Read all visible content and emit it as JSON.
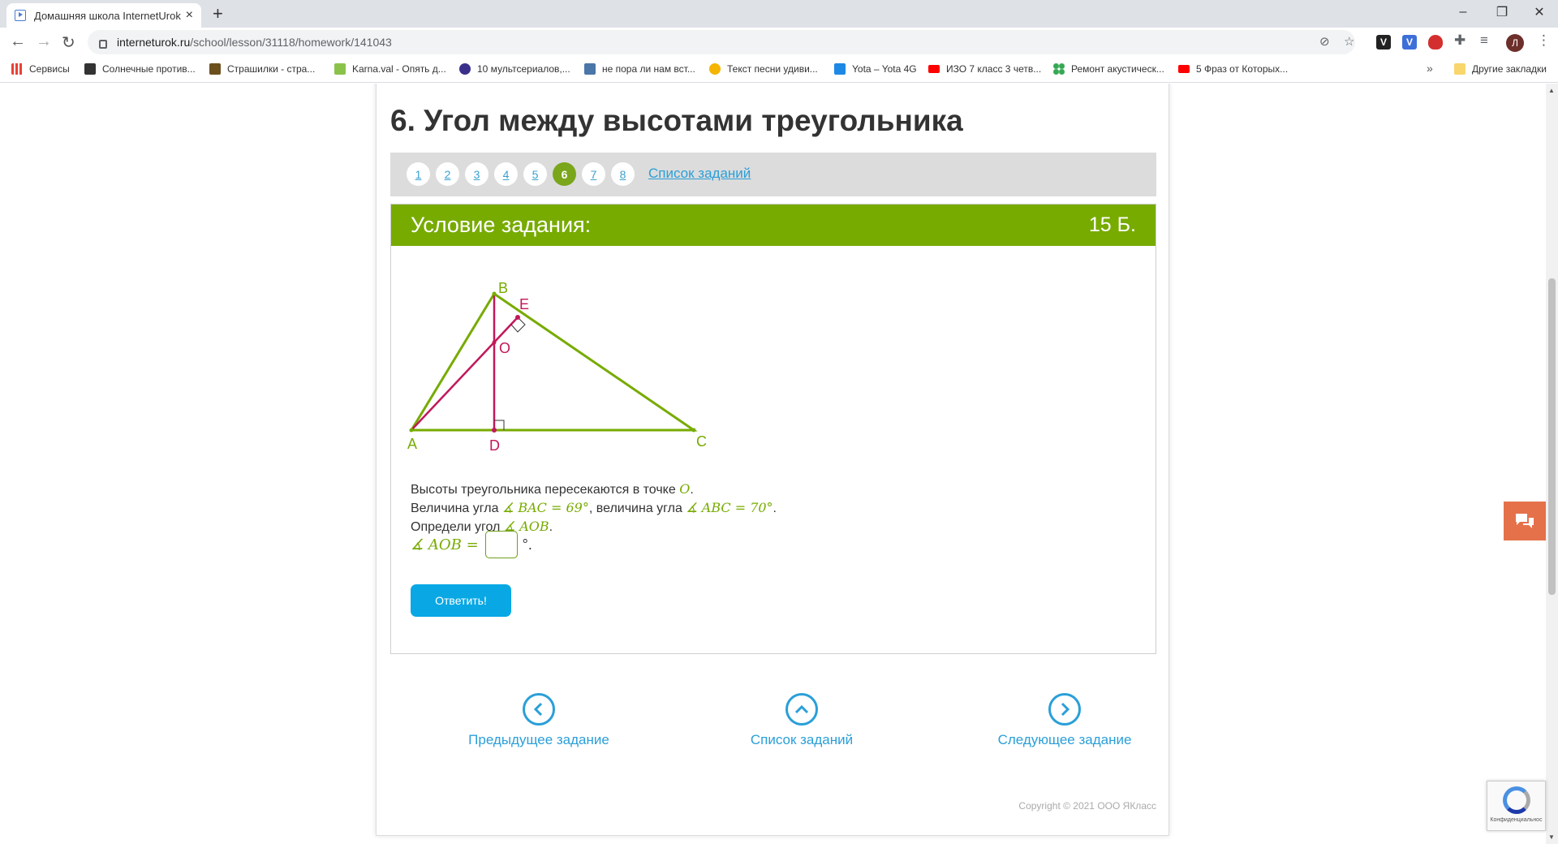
{
  "browser": {
    "tab_title": "Домашняя школа InternetUrok.r",
    "tab_close": "×",
    "new_tab": "+",
    "window_controls": [
      "–",
      "❐",
      "✕"
    ],
    "url_host": "interneturok.ru",
    "url_path": "/school/lesson/31118/homework/141043",
    "extension_letters": [
      "V",
      "V"
    ],
    "avatar_letter": "Л",
    "bookmarks": [
      {
        "label": "Сервисы",
        "icon": "apps-grid-icon",
        "color": "#e94235"
      },
      {
        "label": "Солнечные против...",
        "icon": "bookmark-icon",
        "color": "#333333"
      },
      {
        "label": "Страшилки - стра...",
        "icon": "bookmark-icon",
        "color": "#6b4f1d"
      },
      {
        "label": "Karna.val - Опять д...",
        "icon": "music-icon",
        "color": "#8bc34a"
      },
      {
        "label": "10 мультсериалов,...",
        "icon": "w-icon",
        "color": "#3b2f8c"
      },
      {
        "label": "не пора ли нам вст...",
        "icon": "vk-icon",
        "color": "#4a76a8"
      },
      {
        "label": "Текст песни удиви...",
        "icon": "note-icon",
        "color": "#f4b400"
      },
      {
        "label": "Yota – Yota 4G",
        "icon": "yota-icon",
        "color": "#1e88e5"
      },
      {
        "label": "ИЗО 7 класс 3 четв...",
        "icon": "youtube-icon",
        "color": "#ff0000"
      },
      {
        "label": "Ремонт акустическ...",
        "icon": "dots-icon",
        "color": "#34a853"
      },
      {
        "label": "5 Фраз от Которых...",
        "icon": "youtube-icon",
        "color": "#ff0000"
      }
    ],
    "more_bookmarks": "»",
    "other_bookmarks": "Другие закладки"
  },
  "page": {
    "task_title": "6. Угол между высотами треугольника",
    "pager": {
      "pages": [
        "1",
        "2",
        "3",
        "4",
        "5",
        "6",
        "7",
        "8"
      ],
      "active_page": "6",
      "list_link": "Список заданий"
    },
    "condition": {
      "title": "Условие задания:",
      "points": "15 Б.",
      "figure_labels": {
        "A": "A",
        "B": "B",
        "C": "C",
        "D": "D",
        "E": "E",
        "O": "O"
      },
      "line1_text": "Высоты треугольника пересекаются в точке ",
      "line1_math": "O",
      "line1_end": ".",
      "line2_text_a": "Величина угла ",
      "line2_math_a": "∡ BAC = 69°",
      "line2_text_b": ", величина угла ",
      "line2_math_b": "∡ ABC = 70°",
      "line2_end": ".",
      "line3_text": "Определи угол ",
      "line3_math": "∡ AOB",
      "line3_end": ".",
      "answer_math": "∡ AOB =",
      "answer_value": "",
      "answer_unit": "°.",
      "submit_label": "Ответить!"
    },
    "navigation": {
      "prev": "Предыдущее задание",
      "list": "Список заданий",
      "next": "Следующее задание"
    },
    "copyright": "Copyright © 2021 ООО ЯКласс",
    "recaptcha_text": "Конфиденциальнос"
  },
  "colors": {
    "accent_green": "#77ab00",
    "altitude_magenta": "#c2185b",
    "link_blue": "#2a9fd8",
    "button_blue": "#09a8e4",
    "chat_orange": "#e5714b"
  }
}
